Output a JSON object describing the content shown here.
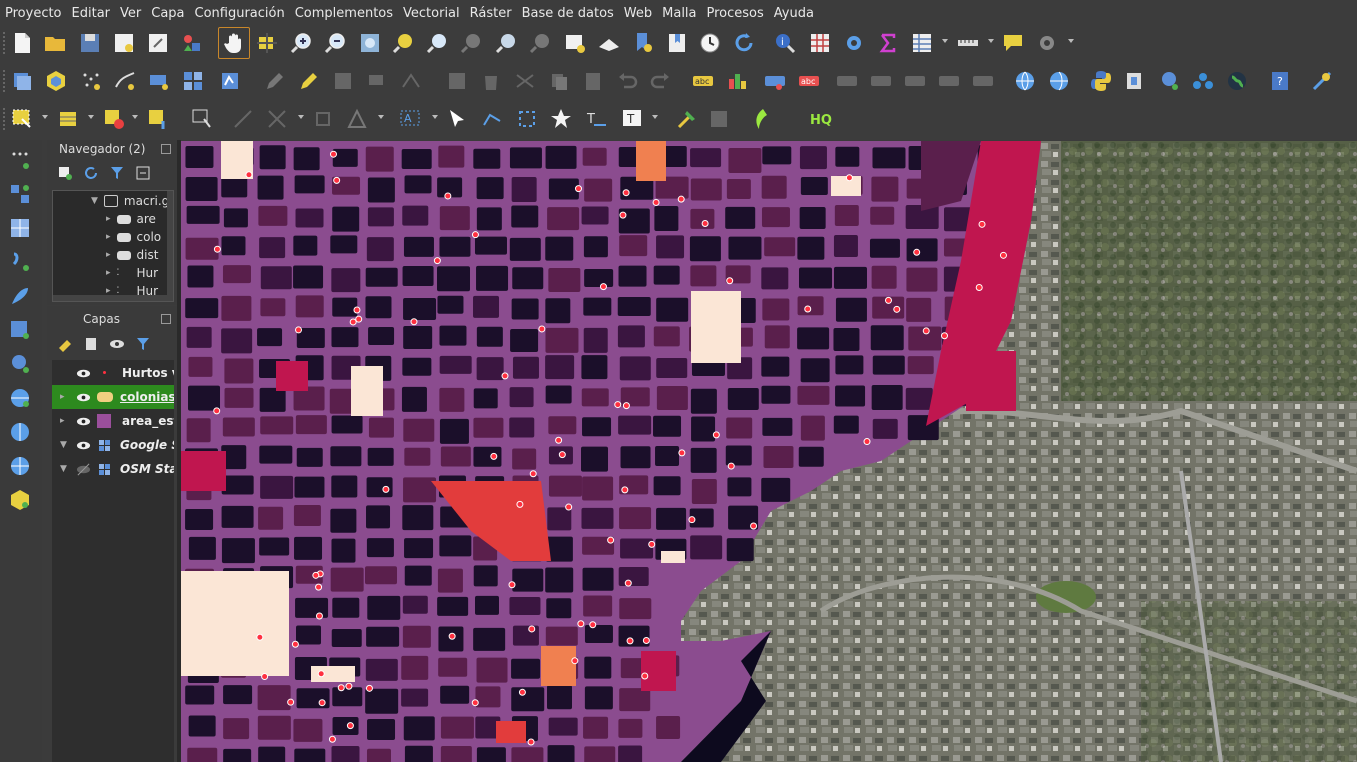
{
  "menu": [
    "Proyecto",
    "Editar",
    "Ver",
    "Capa",
    "Configuración",
    "Complementos",
    "Vectorial",
    "Ráster",
    "Base de datos",
    "Web",
    "Malla",
    "Procesos",
    "Ayuda"
  ],
  "browser_panel": {
    "title": "Navegador (2)",
    "items": [
      "macri.g",
      "are",
      "colo",
      "dist",
      "Hur",
      "Hur"
    ]
  },
  "layers_panel": {
    "title": "Capas",
    "layers": [
      {
        "name": "Hurtos v",
        "visible": true,
        "icon": "point-layer-icon"
      },
      {
        "name": "colonias",
        "visible": true,
        "icon": "polygon-layer-icon",
        "selected": true
      },
      {
        "name": "area_est",
        "visible": true,
        "icon": "fill-layer-icon",
        "swatch": "#9b4f9c"
      },
      {
        "name": "Google S",
        "visible": true,
        "icon": "xyz-layer-icon"
      },
      {
        "name": "OSM Sta",
        "visible": false,
        "icon": "xyz-layer-icon"
      }
    ]
  },
  "colors": {
    "accent_selected": "#2d8a1e",
    "road": "#8b4c8f",
    "block_dark": "#1b0f2a",
    "block_mid": "#5a1f4c",
    "block_pink": "#c0164f",
    "block_orange": "#f08050",
    "block_pale": "#fbe6d6",
    "point": "#ff3040"
  }
}
